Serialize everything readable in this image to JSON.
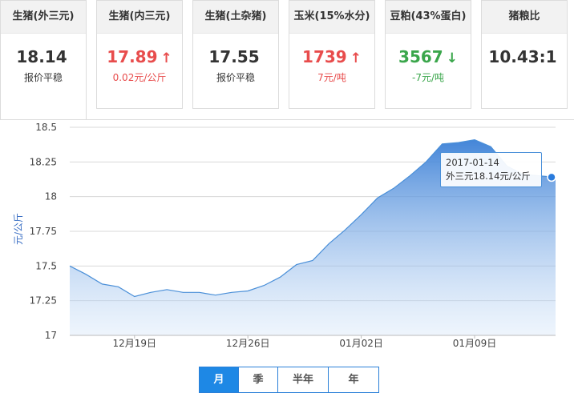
{
  "cards": [
    {
      "title": "生猪(外三元)",
      "value": "18.14",
      "arrow": "",
      "trend": "flat",
      "sub": "报价平稳"
    },
    {
      "title": "生猪(内三元)",
      "value": "17.89",
      "arrow": "↑",
      "trend": "up",
      "sub": "0.02元/公斤"
    },
    {
      "title": "生猪(土杂猪)",
      "value": "17.55",
      "arrow": "",
      "trend": "flat",
      "sub": "报价平稳"
    },
    {
      "title": "玉米(15%水分)",
      "value": "1739",
      "arrow": "↑",
      "trend": "up",
      "sub": "7元/吨"
    },
    {
      "title": "豆粕(43%蛋白)",
      "value": "3567",
      "arrow": "↓",
      "trend": "down",
      "sub": "-7元/吨"
    },
    {
      "title": "猪粮比",
      "value": "10.43:1",
      "arrow": "",
      "trend": "flat",
      "sub": ""
    }
  ],
  "colors": {
    "up": "#e84c4c",
    "down": "#3aa64b",
    "line": "#4a8fd8",
    "accent": "#1e88e5"
  },
  "chart_data": {
    "type": "area",
    "title": "",
    "xlabel": "",
    "ylabel": "元/公斤",
    "ylim": [
      17,
      18.5
    ],
    "yticks": [
      17,
      17.25,
      17.5,
      17.75,
      18,
      18.25,
      18.5
    ],
    "ytick_labels": [
      "17",
      "17.25",
      "17.5",
      "17.75",
      "18",
      "18.25",
      "18.5"
    ],
    "x_tick_labels": [
      "12月19日",
      "12月26日",
      "01月02日",
      "01月09日"
    ],
    "x_tick_dates": [
      "2016-12-19",
      "2016-12-26",
      "2017-01-02",
      "2017-01-09"
    ],
    "grid": true,
    "series": [
      {
        "x": [
          "2016-12-15",
          "2016-12-16",
          "2016-12-17",
          "2016-12-18",
          "2016-12-19",
          "2016-12-20",
          "2016-12-21",
          "2016-12-22",
          "2016-12-23",
          "2016-12-24",
          "2016-12-25",
          "2016-12-26",
          "2016-12-27",
          "2016-12-28",
          "2016-12-29",
          "2016-12-30",
          "2016-12-31",
          "2017-01-01",
          "2017-01-02",
          "2017-01-03",
          "2017-01-04",
          "2017-01-05",
          "2017-01-06",
          "2017-01-07",
          "2017-01-08",
          "2017-01-09",
          "2017-01-10",
          "2017-01-11",
          "2017-01-12",
          "2017-01-13",
          "2017-01-14"
        ],
        "values": [
          17.5,
          17.44,
          17.37,
          17.35,
          17.28,
          17.31,
          17.33,
          17.31,
          17.31,
          17.29,
          17.31,
          17.32,
          17.36,
          17.42,
          17.51,
          17.54,
          17.66,
          17.76,
          17.87,
          17.99,
          18.06,
          18.15,
          18.25,
          18.38,
          18.39,
          18.41,
          18.36,
          18.22,
          18.16,
          18.15,
          18.14
        ]
      }
    ],
    "tooltip": {
      "date": "2017-01-14",
      "text": "外三元18.14元/公斤"
    }
  },
  "tabs": [
    "月",
    "季",
    "半年",
    "年"
  ],
  "active_tab": 0
}
